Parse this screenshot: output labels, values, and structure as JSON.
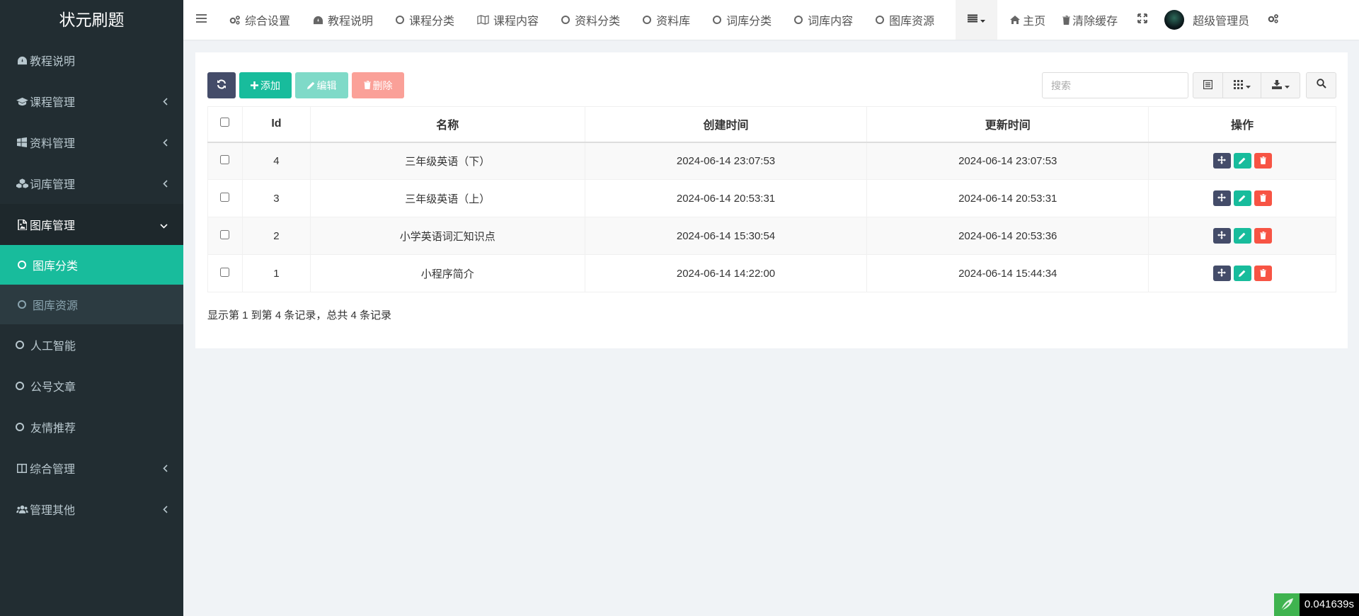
{
  "brand": "状元刷题",
  "sidebar": {
    "items": [
      {
        "label": "教程说明"
      },
      {
        "label": "课程管理"
      },
      {
        "label": "资料管理"
      },
      {
        "label": "词库管理"
      },
      {
        "label": "图库管理"
      },
      {
        "label": "图库分类"
      },
      {
        "label": "图库资源"
      },
      {
        "label": "人工智能"
      },
      {
        "label": "公号文章"
      },
      {
        "label": "友情推荐"
      },
      {
        "label": "综合管理"
      },
      {
        "label": "管理其他"
      }
    ]
  },
  "topnav": {
    "items": [
      "综合设置",
      "教程说明",
      "课程分类",
      "课程内容",
      "资料分类",
      "资料库",
      "词库分类",
      "词库内容",
      "图库资源"
    ],
    "home": "主页",
    "clear_cache": "清除缓存",
    "user": "超级管理员"
  },
  "toolbar": {
    "add": "添加",
    "edit": "编辑",
    "delete": "删除"
  },
  "search": {
    "placeholder": "搜索"
  },
  "table": {
    "headers": [
      "Id",
      "名称",
      "创建时间",
      "更新时间",
      "操作"
    ],
    "rows": [
      {
        "id": "4",
        "name": "三年级英语（下）",
        "created": "2024-06-14 23:07:53",
        "updated": "2024-06-14 23:07:53"
      },
      {
        "id": "3",
        "name": "三年级英语（上）",
        "created": "2024-06-14 20:53:31",
        "updated": "2024-06-14 20:53:31"
      },
      {
        "id": "2",
        "name": "小学英语词汇知识点",
        "created": "2024-06-14 15:30:54",
        "updated": "2024-06-14 20:53:36"
      },
      {
        "id": "1",
        "name": "小程序简介",
        "created": "2024-06-14 14:22:00",
        "updated": "2024-06-14 15:44:34"
      }
    ]
  },
  "pagination": {
    "text": "显示第 1 到第 4 条记录，总共 4 条记录"
  },
  "timer": {
    "value": "0.041639s"
  },
  "colors": {
    "sidebar": "#222d32",
    "accent": "#18bc9c",
    "danger": "#f75444",
    "dark_button": "#444c69"
  }
}
